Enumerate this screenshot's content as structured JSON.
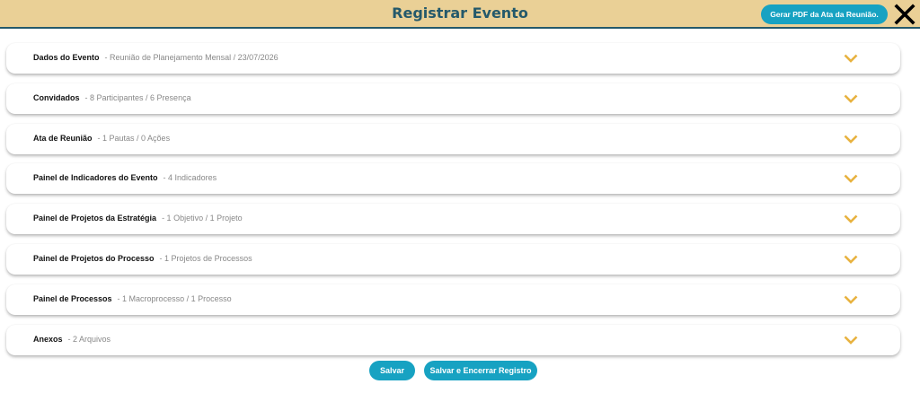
{
  "header": {
    "title": "Registrar Evento",
    "pdf_button": "Gerar PDF da Ata da Reunião.",
    "close_icon": "close-icon"
  },
  "panels": [
    {
      "title": "Dados do Evento",
      "subtitle": "- Reunião de Planejamento Mensal / 23/07/2026"
    },
    {
      "title": "Convidados",
      "subtitle": "- 8 Participantes / 6 Presença"
    },
    {
      "title": "Ata de Reunião",
      "subtitle": "- 1 Pautas / 0 Ações"
    },
    {
      "title": "Painel de Indicadores do Evento",
      "subtitle": "- 4 Indicadores"
    },
    {
      "title": "Painel de Projetos da Estratégia",
      "subtitle": "- 1 Objetivo / 1 Projeto"
    },
    {
      "title": "Painel de Projetos do Processo",
      "subtitle": "- 1 Projetos de Processos"
    },
    {
      "title": "Painel de Processos",
      "subtitle": "- 1 Macroprocesso / 1 Processo"
    },
    {
      "title": "Anexos",
      "subtitle": "- 2 Arquivos"
    }
  ],
  "footer": {
    "save": "Salvar",
    "save_close": "Salvar e Encerrar Registro"
  },
  "colors": {
    "header_bg": "#ead096",
    "title_color": "#24596b",
    "button_bg": "#17a2c2",
    "chevron": "#e8b23f"
  }
}
